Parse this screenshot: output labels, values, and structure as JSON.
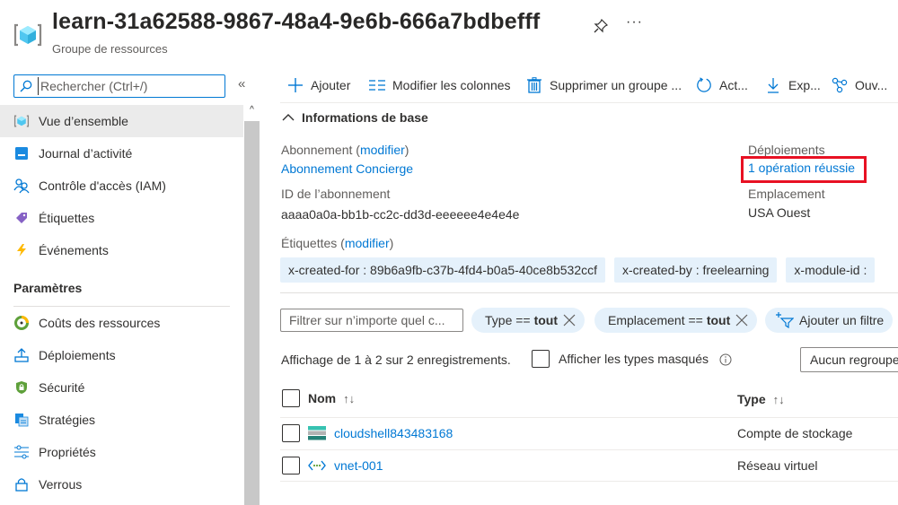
{
  "header": {
    "title": "learn-31a62588-9867-48a4-9e6b-666a7bdbefff",
    "subtitle": "Groupe de ressources",
    "icons": {
      "resource_group": "resource-group-icon",
      "pin": "pin-icon",
      "more": "more-icon"
    },
    "more_label": "···"
  },
  "sidebar": {
    "search": {
      "placeholder": "Rechercher (Ctrl+/)",
      "value": ""
    },
    "collapse_label": "«",
    "items": [
      {
        "label": "Vue d’ensemble",
        "icon": "resource-group-icon",
        "active": true
      },
      {
        "label": "Journal d’activité",
        "icon": "activity-log-icon"
      },
      {
        "label": "Contrôle d'accès (IAM)",
        "icon": "iam-icon"
      },
      {
        "label": "Étiquettes",
        "icon": "tag-icon"
      },
      {
        "label": "Événements",
        "icon": "lightning-icon"
      }
    ],
    "section_title": "Paramètres",
    "settings_items": [
      {
        "label": "Coûts des ressources",
        "icon": "cost-icon"
      },
      {
        "label": "Déploiements",
        "icon": "upload-icon"
      },
      {
        "label": "Sécurité",
        "icon": "shield-icon"
      },
      {
        "label": "Stratégies",
        "icon": "policy-icon"
      },
      {
        "label": "Propriétés",
        "icon": "properties-icon"
      },
      {
        "label": "Verrous",
        "icon": "lock-icon"
      }
    ]
  },
  "toolbar": {
    "buttons": [
      {
        "label": "Ajouter",
        "icon": "plus-icon"
      },
      {
        "label": "Modifier les colonnes",
        "icon": "columns-icon"
      },
      {
        "label": "Supprimer un groupe ...",
        "icon": "trash-icon"
      },
      {
        "label": "Act...",
        "icon": "refresh-icon"
      },
      {
        "label": "Exp...",
        "icon": "download-icon"
      },
      {
        "label": "Ouv...",
        "icon": "share-icon"
      }
    ]
  },
  "essentials": {
    "toggle_label": "Informations de base",
    "subscription_label": "Abonnement",
    "modify_link": "modifier",
    "subscription_value": "Abonnement Concierge",
    "subscription_id_label": "ID de l’abonnement",
    "subscription_id_value": "aaaa0a0a-bb1b-cc2c-dd3d-eeeeee4e4e4e",
    "tags_label": "Étiquettes",
    "deployments_label": "Déploiements",
    "deployments_value": "1 opération réussie",
    "location_label": "Emplacement",
    "location_value": "USA Ouest",
    "highlight_color": "#e81123",
    "tags": [
      "x-created-for : 89b6a9fb-c37b-4fd4-b0a5-40ce8b532ccf",
      "x-created-by : freelearning",
      "x-module-id :"
    ]
  },
  "filters": {
    "search_placeholder": "Filtrer sur n’importe quel c...",
    "pills": [
      {
        "prefix": "Type ==",
        "value": "tout"
      },
      {
        "prefix": "Emplacement ==",
        "value": "tout"
      }
    ],
    "add_filter_label": "Ajouter un filtre",
    "records_text": "Affichage de 1 à 2 sur 2 enregistrements.",
    "show_hidden_label": "Afficher les types masqués",
    "grouping_value": "Aucun regroupement"
  },
  "table": {
    "columns": [
      {
        "label": "Nom",
        "sort": "↑↓"
      },
      {
        "label": "Type",
        "sort": "↑↓"
      }
    ],
    "rows": [
      {
        "name": "cloudshell843483168",
        "type": "Compte de stockage",
        "icon": "storage-account-icon"
      },
      {
        "name": "vnet-001",
        "type": "Réseau virtuel",
        "icon": "virtual-network-icon"
      }
    ]
  },
  "colors": {
    "accent": "#0078d4",
    "tag_bg": "#e5f1fb",
    "active_nav_bg": "#ebebeb"
  }
}
